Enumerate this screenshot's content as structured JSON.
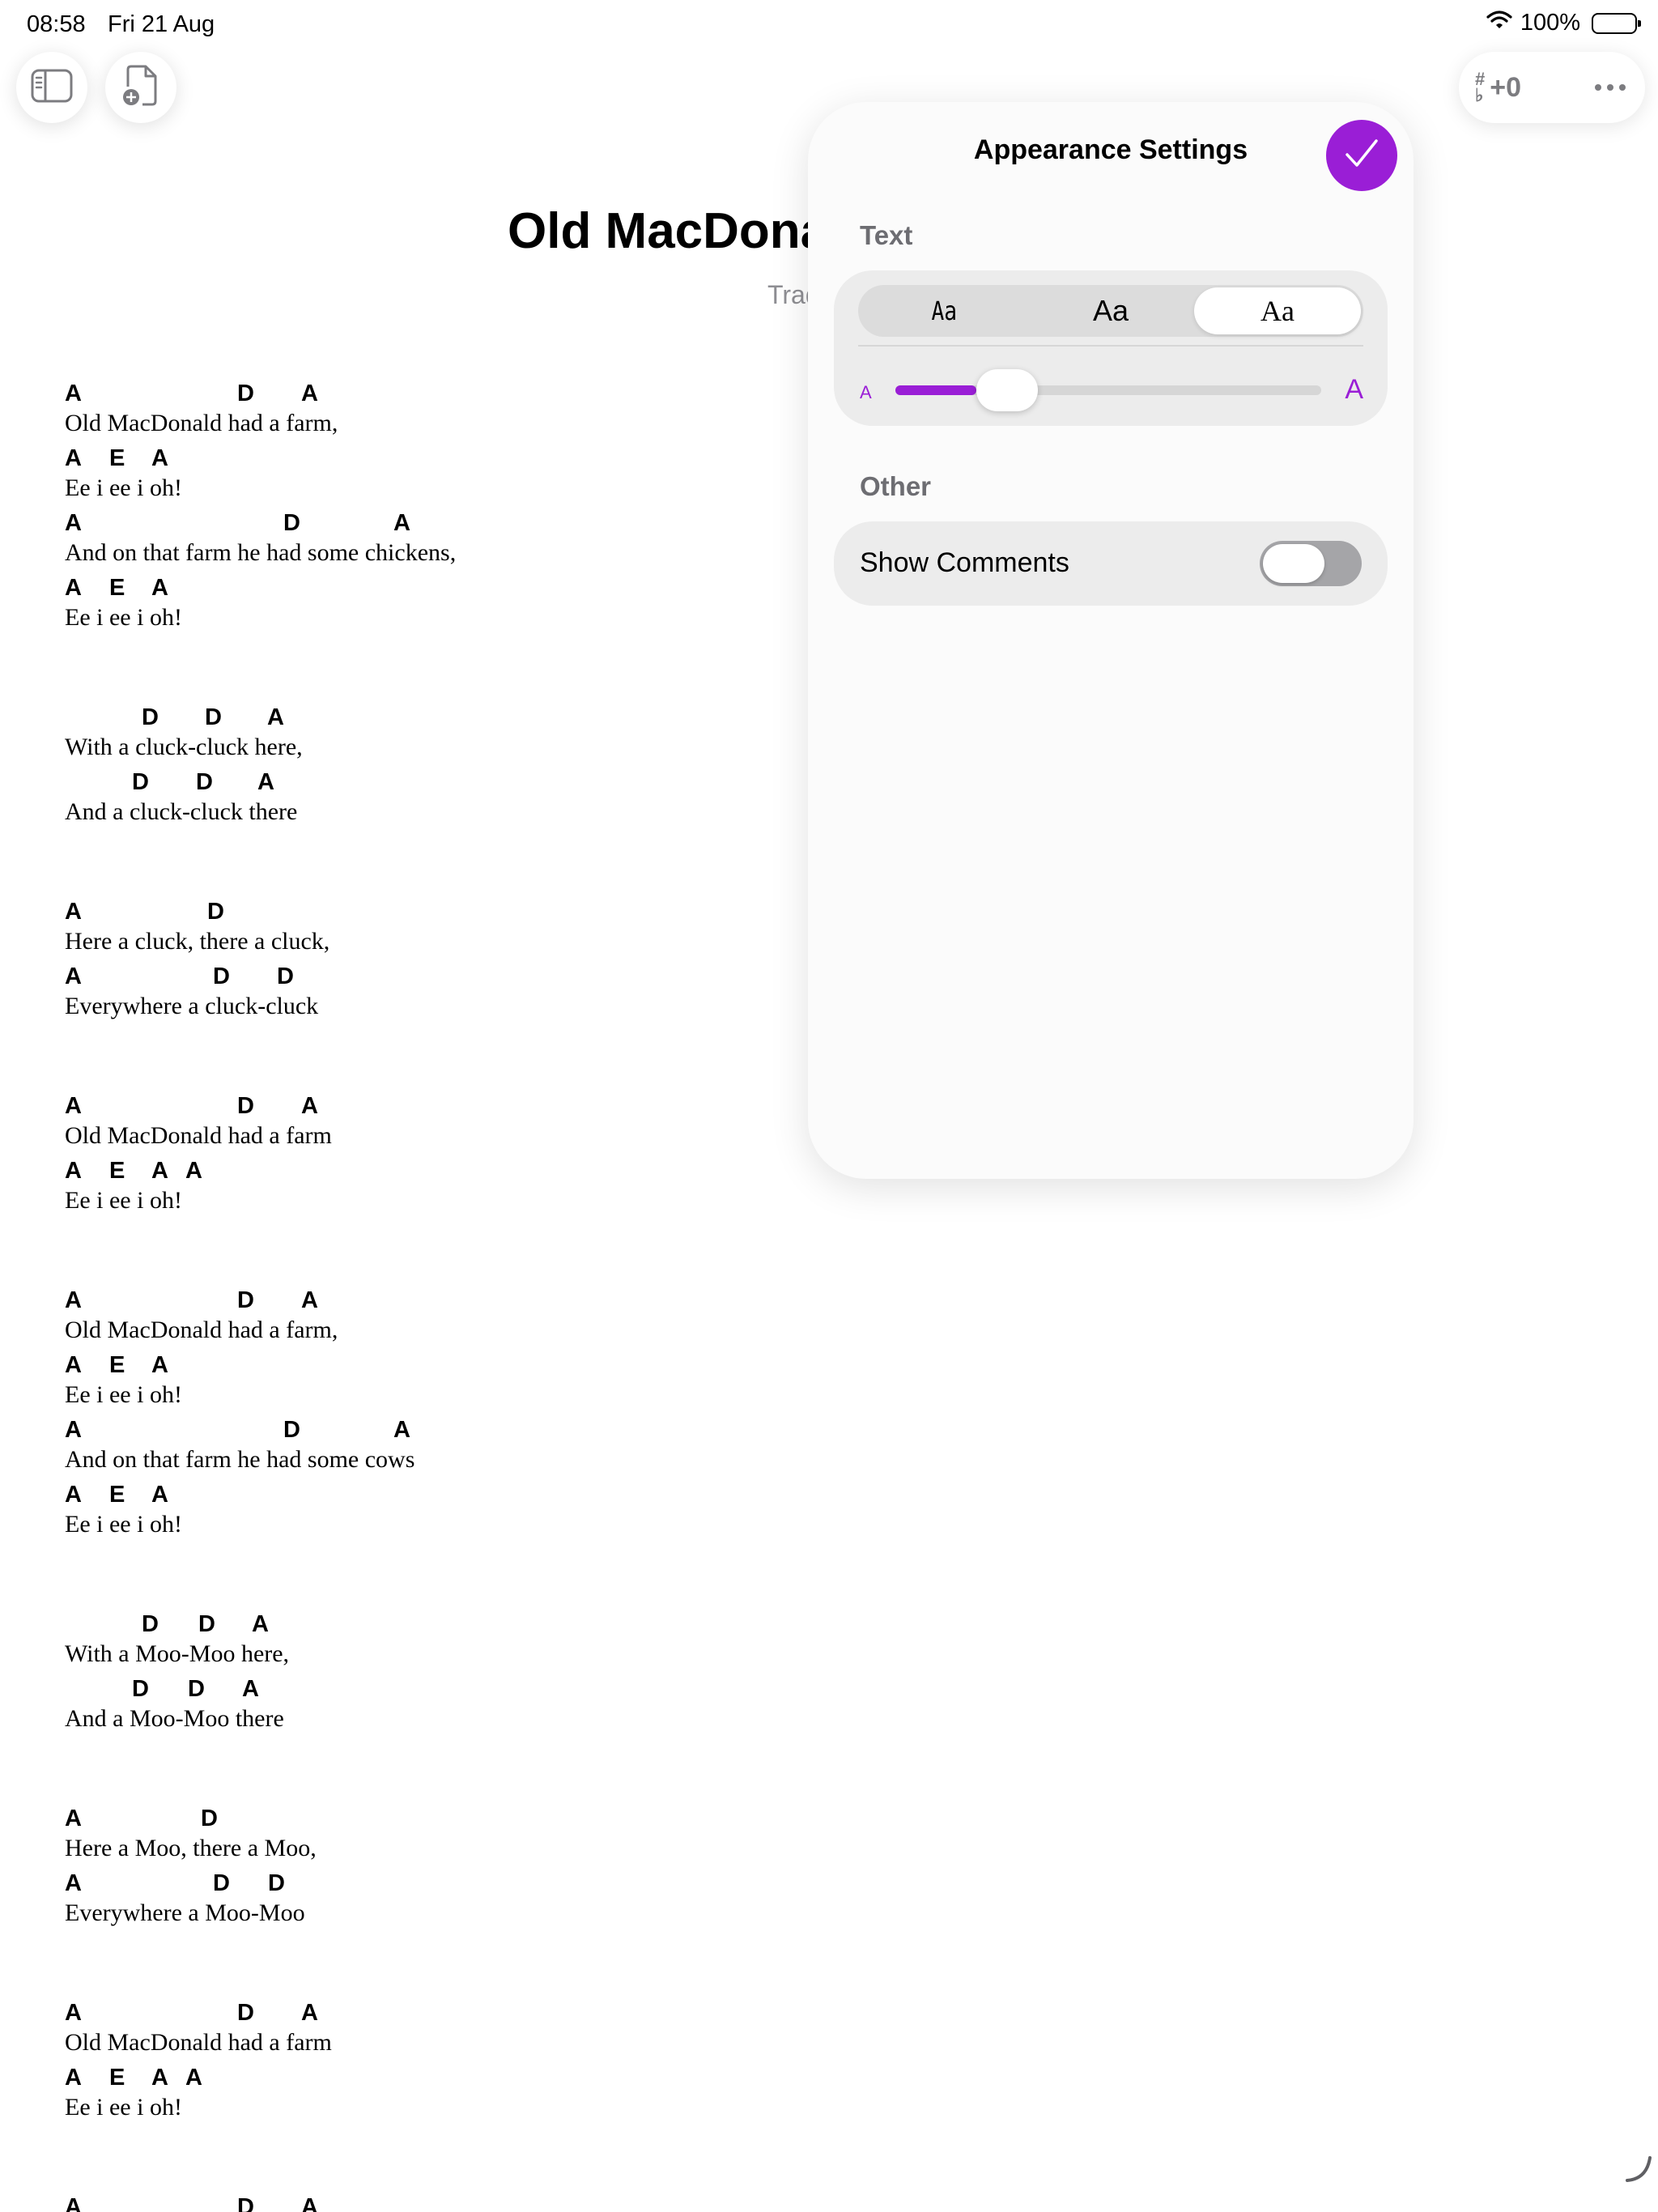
{
  "status": {
    "time": "08:58",
    "date": "Fri 21 Aug",
    "battery": "100%"
  },
  "toolbar": {
    "sidebar_icon": "sidebar-icon",
    "new_document_icon": "add-document-icon",
    "transpose_sharp": "#",
    "transpose_flat": "♭",
    "transpose_value": "+0",
    "more_icon": "ellipsis-icon"
  },
  "song": {
    "title": "Old MacDonald Had A Farm",
    "subtitle": "Traditional"
  },
  "lyrics": [
    {
      "chords": [
        {
          "c": "A",
          "pos": 0
        },
        {
          "c": "D",
          "pos": 213
        },
        {
          "c": "A",
          "pos": 292
        }
      ],
      "text": "Old MacDonald had a farm,"
    },
    {
      "chords": [
        {
          "c": "A",
          "pos": 0
        },
        {
          "c": "E",
          "pos": 55
        },
        {
          "c": "A",
          "pos": 107
        }
      ],
      "text": "Ee i ee i oh!"
    },
    {
      "chords": [
        {
          "c": "A",
          "pos": 0
        },
        {
          "c": "D",
          "pos": 270
        },
        {
          "c": "A",
          "pos": 406
        }
      ],
      "text": "And on that farm he had some chickens,"
    },
    {
      "chords": [
        {
          "c": "A",
          "pos": 0
        },
        {
          "c": "E",
          "pos": 55
        },
        {
          "c": "A",
          "pos": 107
        }
      ],
      "text": "Ee i ee i oh!"
    },
    {
      "chords": [
        {
          "c": "D",
          "pos": 95
        },
        {
          "c": "D",
          "pos": 173
        },
        {
          "c": "A",
          "pos": 250
        }
      ],
      "text": "With a cluck-cluck here,"
    },
    {
      "chords": [
        {
          "c": "D",
          "pos": 83
        },
        {
          "c": "D",
          "pos": 162
        },
        {
          "c": "A",
          "pos": 238
        }
      ],
      "text": "And a cluck-cluck there"
    },
    {
      "chords": [
        {
          "c": "A",
          "pos": 0
        },
        {
          "c": "D",
          "pos": 176
        }
      ],
      "text": "Here a cluck, there a cluck,"
    },
    {
      "chords": [
        {
          "c": "A",
          "pos": 0
        },
        {
          "c": "D",
          "pos": 183
        },
        {
          "c": "D",
          "pos": 262
        }
      ],
      "text": "Everywhere a cluck-cluck"
    },
    {
      "chords": [
        {
          "c": "A",
          "pos": 0
        },
        {
          "c": "D",
          "pos": 213
        },
        {
          "c": "A",
          "pos": 292
        }
      ],
      "text": "Old MacDonald had a farm"
    },
    {
      "chords": [
        {
          "c": "A",
          "pos": 0
        },
        {
          "c": "E",
          "pos": 55
        },
        {
          "c": "A",
          "pos": 107
        },
        {
          "c": "A",
          "pos": 149
        }
      ],
      "text": "Ee i ee i oh!"
    },
    {
      "chords": [
        {
          "c": "A",
          "pos": 0
        },
        {
          "c": "D",
          "pos": 213
        },
        {
          "c": "A",
          "pos": 292
        }
      ],
      "text": "Old MacDonald had a farm,"
    },
    {
      "chords": [
        {
          "c": "A",
          "pos": 0
        },
        {
          "c": "E",
          "pos": 55
        },
        {
          "c": "A",
          "pos": 107
        }
      ],
      "text": "Ee i ee i oh!"
    },
    {
      "chords": [
        {
          "c": "A",
          "pos": 0
        },
        {
          "c": "D",
          "pos": 270
        },
        {
          "c": "A",
          "pos": 406
        }
      ],
      "text": "And on that farm he had some cows"
    },
    {
      "chords": [
        {
          "c": "A",
          "pos": 0
        },
        {
          "c": "E",
          "pos": 55
        },
        {
          "c": "A",
          "pos": 107
        }
      ],
      "text": "Ee i ee i oh!"
    },
    {
      "chords": [
        {
          "c": "D",
          "pos": 95
        },
        {
          "c": "D",
          "pos": 165
        },
        {
          "c": "A",
          "pos": 231
        }
      ],
      "text": "With a Moo-Moo here,"
    },
    {
      "chords": [
        {
          "c": "D",
          "pos": 83
        },
        {
          "c": "D",
          "pos": 152
        },
        {
          "c": "A",
          "pos": 219
        }
      ],
      "text": "And a Moo-Moo there"
    },
    {
      "chords": [
        {
          "c": "A",
          "pos": 0
        },
        {
          "c": "D",
          "pos": 168
        }
      ],
      "text": "Here a Moo, there a Moo,"
    },
    {
      "chords": [
        {
          "c": "A",
          "pos": 0
        },
        {
          "c": "D",
          "pos": 183
        },
        {
          "c": "D",
          "pos": 251
        }
      ],
      "text": "Everywhere a Moo-Moo"
    },
    {
      "chords": [
        {
          "c": "A",
          "pos": 0
        },
        {
          "c": "D",
          "pos": 213
        },
        {
          "c": "A",
          "pos": 292
        }
      ],
      "text": "Old MacDonald had a farm"
    },
    {
      "chords": [
        {
          "c": "A",
          "pos": 0
        },
        {
          "c": "E",
          "pos": 55
        },
        {
          "c": "A",
          "pos": 107
        },
        {
          "c": "A",
          "pos": 149
        }
      ],
      "text": "Ee i ee i oh!"
    },
    {
      "chords": [
        {
          "c": "A",
          "pos": 0
        },
        {
          "c": "D",
          "pos": 213
        },
        {
          "c": "A",
          "pos": 292
        }
      ],
      "text": ""
    }
  ],
  "panel": {
    "title": "Appearance Settings",
    "done_icon": "checkmark-icon",
    "text_section": "Text",
    "font_options": [
      "Aa",
      "Aa",
      "Aa"
    ],
    "selected_font_index": 2,
    "size_small_label": "A",
    "size_large_label": "A",
    "size_value": 0.19,
    "other_section": "Other",
    "show_comments_label": "Show Comments",
    "show_comments_on": false
  },
  "colors": {
    "accent": "#9a1ed6",
    "secondary_text": "#8e8e93"
  }
}
